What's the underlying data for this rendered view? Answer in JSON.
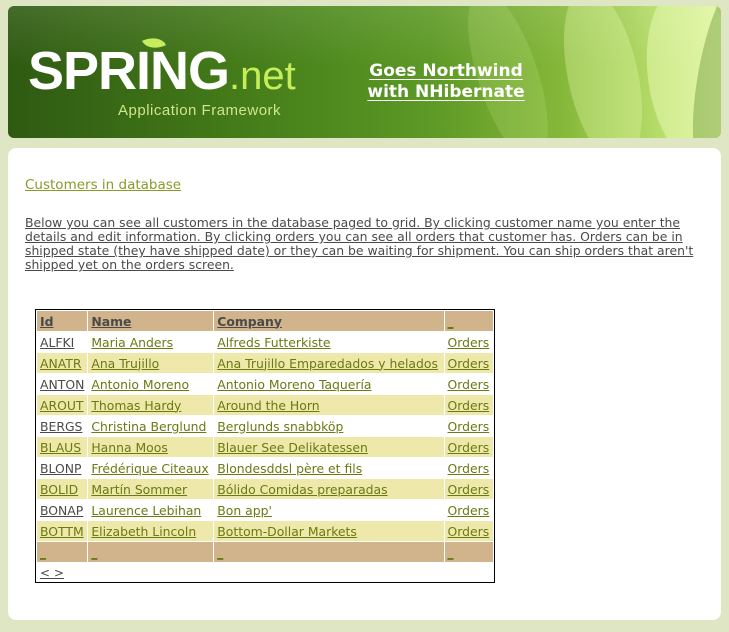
{
  "header": {
    "logo_main": "SPRING",
    "logo_suffix": ".net",
    "tagline": "Application Framework",
    "title_line1": "Goes Northwind",
    "title_line2": "with NHibernate"
  },
  "main": {
    "heading": "Customers in database",
    "description": "Below you can see all customers in the database paged to grid. By clicking customer name you enter the details and edit information. By clicking orders you can see all orders that customer has. Orders can be in shipped state (they have shipped date) or they can be waiting for shipment. You can ship orders that aren't shipped yet on the orders screen."
  },
  "grid": {
    "columns": [
      "Id",
      "Name",
      "Company",
      "_"
    ],
    "rows": [
      {
        "id": "ALFKI",
        "name": "Maria Anders",
        "company": "Alfreds Futterkiste",
        "orders": "Orders"
      },
      {
        "id": "ANATR",
        "name": "Ana Trujillo",
        "company": "Ana Trujillo Emparedados y helados",
        "orders": "Orders"
      },
      {
        "id": "ANTON",
        "name": "Antonio Moreno",
        "company": "Antonio Moreno Taquería",
        "orders": "Orders"
      },
      {
        "id": "AROUT",
        "name": "Thomas Hardy",
        "company": "Around the Horn",
        "orders": "Orders"
      },
      {
        "id": "BERGS",
        "name": "Christina Berglund",
        "company": "Berglunds snabbköp",
        "orders": "Orders"
      },
      {
        "id": "BLAUS",
        "name": "Hanna Moos",
        "company": "Blauer See Delikatessen",
        "orders": "Orders"
      },
      {
        "id": "BLONP",
        "name": "Frédérique Citeaux",
        "company": "Blondesddsl père et fils",
        "orders": "Orders"
      },
      {
        "id": "BOLID",
        "name": "Martín Sommer",
        "company": "Bólido Comidas preparadas",
        "orders": "Orders"
      },
      {
        "id": "BONAP",
        "name": "Laurence Lebihan",
        "company": "Bon app'",
        "orders": "Orders"
      },
      {
        "id": "BOTTM",
        "name": "Elizabeth Lincoln",
        "company": "Bottom-Dollar Markets",
        "orders": "Orders"
      }
    ],
    "footer": [
      "_",
      "_",
      "_",
      "_"
    ],
    "pager": "< >"
  },
  "colors": {
    "header_row": "#d2b48c",
    "alt_row": "#eee8aa",
    "link": "#6b7a12",
    "heading": "#8a9a2a"
  }
}
